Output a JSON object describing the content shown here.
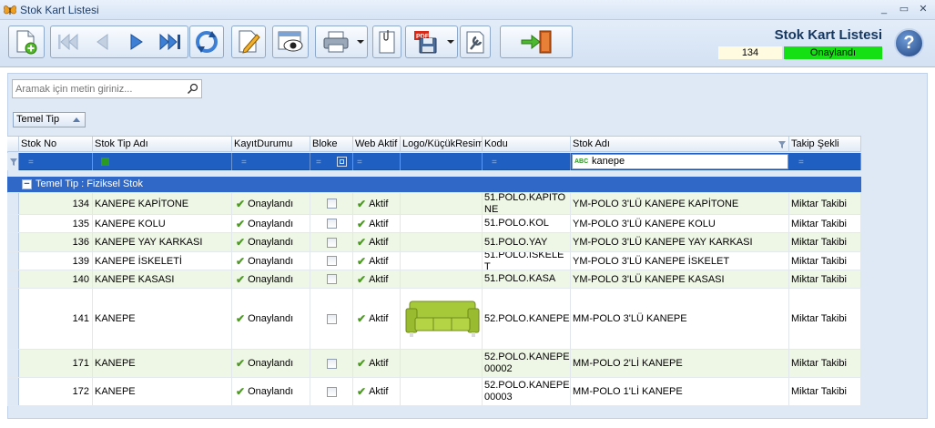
{
  "window": {
    "title": "Stok Kart Listesi",
    "controls": [
      "_",
      "▭",
      "✕"
    ]
  },
  "header": {
    "title": "Stok Kart Listesi",
    "count": "134",
    "status": "Onaylandı",
    "status_color": "#14e014",
    "help_label": "?"
  },
  "toolbar": {
    "buttons": [
      {
        "name": "new-record",
        "icon": "new-document-icon"
      },
      {
        "name": "first-record",
        "icon": "first-icon"
      },
      {
        "name": "previous-record",
        "icon": "previous-icon"
      },
      {
        "name": "next-record",
        "icon": "next-icon"
      },
      {
        "name": "last-record",
        "icon": "last-icon"
      },
      {
        "name": "refresh",
        "icon": "refresh-icon"
      },
      {
        "name": "edit",
        "icon": "edit-icon"
      },
      {
        "name": "preview",
        "icon": "preview-icon"
      },
      {
        "name": "print",
        "icon": "printer-icon"
      },
      {
        "name": "attachment",
        "icon": "attachment-icon"
      },
      {
        "name": "export-pdf",
        "icon": "pdf-save-icon"
      },
      {
        "name": "tools",
        "icon": "wrench-icon"
      },
      {
        "name": "exit",
        "icon": "exit-door-icon"
      }
    ]
  },
  "search": {
    "placeholder": "Aramak için metin giriniz..."
  },
  "group_panel": {
    "chip_label": "Temel Tip"
  },
  "grid": {
    "columns": [
      "Stok No",
      "Stok Tip Adı",
      "KayıtDurumu",
      "Bloke",
      "Web Aktif",
      "Logo/KüçükResim",
      "Kodu",
      "Stok Adı",
      "Takip Şekli"
    ],
    "filter": {
      "stok_adi_value": "kanepe",
      "filter_mode_badge": "ABC"
    },
    "group_row": "Temel Tip : Fiziksel Stok",
    "rows": [
      {
        "stok_no": "134",
        "tip": "KANEPE KAPİTONE",
        "kayit": "Onaylandı",
        "bloke": false,
        "web": "Aktif",
        "has_image": false,
        "kodu": "51.POLO.KAPİTONE",
        "stok_adi": "YM-POLO 3'LÜ KANEPE KAPİTONE",
        "takip": "Miktar Takibi"
      },
      {
        "stok_no": "135",
        "tip": "KANEPE KOLU",
        "kayit": "Onaylandı",
        "bloke": false,
        "web": "Aktif",
        "has_image": false,
        "kodu": "51.POLO.KOL",
        "stok_adi": "YM-POLO 3'LÜ KANEPE KOLU",
        "takip": "Miktar Takibi"
      },
      {
        "stok_no": "136",
        "tip": "KANEPE YAY KARKASI",
        "kayit": "Onaylandı",
        "bloke": false,
        "web": "Aktif",
        "has_image": false,
        "kodu": "51.POLO.YAY",
        "stok_adi": "YM-POLO 3'LÜ KANEPE YAY KARKASI",
        "takip": "Miktar Takibi"
      },
      {
        "stok_no": "139",
        "tip": "KANEPE İSKELETİ",
        "kayit": "Onaylandı",
        "bloke": false,
        "web": "Aktif",
        "has_image": false,
        "kodu": "51.POLO.İSKELET",
        "stok_adi": "YM-POLO 3'LÜ KANEPE İSKELET",
        "takip": "Miktar Takibi"
      },
      {
        "stok_no": "140",
        "tip": "KANEPE KASASI",
        "kayit": "Onaylandı",
        "bloke": false,
        "web": "Aktif",
        "has_image": false,
        "kodu": "51.POLO.KASA",
        "stok_adi": "YM-POLO 3'LÜ KANEPE KASASI",
        "takip": "Miktar Takibi"
      },
      {
        "stok_no": "141",
        "tip": "KANEPE",
        "kayit": "Onaylandı",
        "bloke": false,
        "web": "Aktif",
        "has_image": true,
        "kodu": "52.POLO.KANEPE",
        "stok_adi": "MM-POLO 3'LÜ KANEPE",
        "takip": "Miktar Takibi"
      },
      {
        "stok_no": "171",
        "tip": "KANEPE",
        "kayit": "Onaylandı",
        "bloke": false,
        "web": "Aktif",
        "has_image": false,
        "kodu": "52.POLO.KANEPE00002",
        "stok_adi": "MM-POLO 2'Lİ KANEPE",
        "takip": "Miktar Takibi"
      },
      {
        "stok_no": "172",
        "tip": "KANEPE",
        "kayit": "Onaylandı",
        "bloke": false,
        "web": "Aktif",
        "has_image": false,
        "kodu": "52.POLO.KANEPE00003",
        "stok_adi": "MM-POLO 1'Lİ KANEPE",
        "takip": "Miktar Takibi"
      }
    ]
  },
  "colors": {
    "selection_blue": "#1f5fc2",
    "group_row_blue": "#2f68c6",
    "alt_row_green": "#eef6e6",
    "tick_green": "#4f9a25",
    "sofa_green": "#a6c93a"
  }
}
